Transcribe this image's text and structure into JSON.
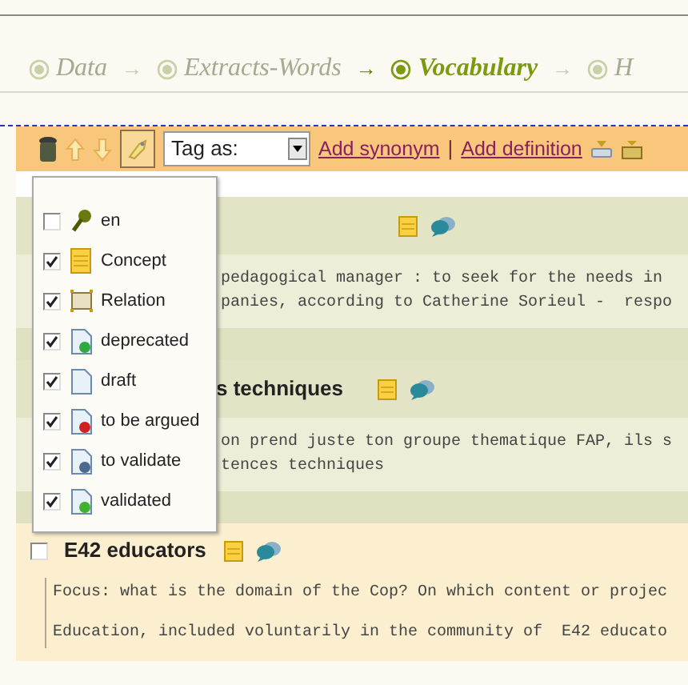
{
  "breadcrumb": {
    "separator": "→",
    "steps": [
      {
        "label": "Data",
        "selected": false
      },
      {
        "label": "Extracts-Words",
        "selected": false
      },
      {
        "label": "Vocabulary",
        "selected": true
      },
      {
        "label": "H",
        "selected": false
      }
    ]
  },
  "toolbar": {
    "tag_select": {
      "value": "Tag as:"
    },
    "links": [
      "Add synonym",
      "Add definition"
    ],
    "link_separator": "|"
  },
  "filter_menu": {
    "items": [
      {
        "label": "en",
        "checked": false
      },
      {
        "label": "Concept",
        "checked": true
      },
      {
        "label": "Relation",
        "checked": true
      },
      {
        "label": "deprecated",
        "checked": true
      },
      {
        "label": "draft",
        "checked": true
      },
      {
        "label": "to be argued",
        "checked": true
      },
      {
        "label": "to validate",
        "checked": true
      },
      {
        "label": "validated",
        "checked": true
      }
    ]
  },
  "entries": [
    {
      "kind": "partial",
      "lines": [
        "pedagogical manager : to seek for the needs in",
        "panies, according to Catherine Sorieul -  respo"
      ]
    },
    {
      "kind": "partial",
      "title": "s techniques",
      "lines": [
        "on prend juste ton groupe thematique FAP, ils s",
        "tences techniques"
      ]
    },
    {
      "kind": "full",
      "title": "E42 educators",
      "checked": false,
      "lines": [
        "Focus: what is the domain of the Cop? On which content or projec",
        "Education, included voluntarily in the community of  E42 educato"
      ]
    }
  ]
}
